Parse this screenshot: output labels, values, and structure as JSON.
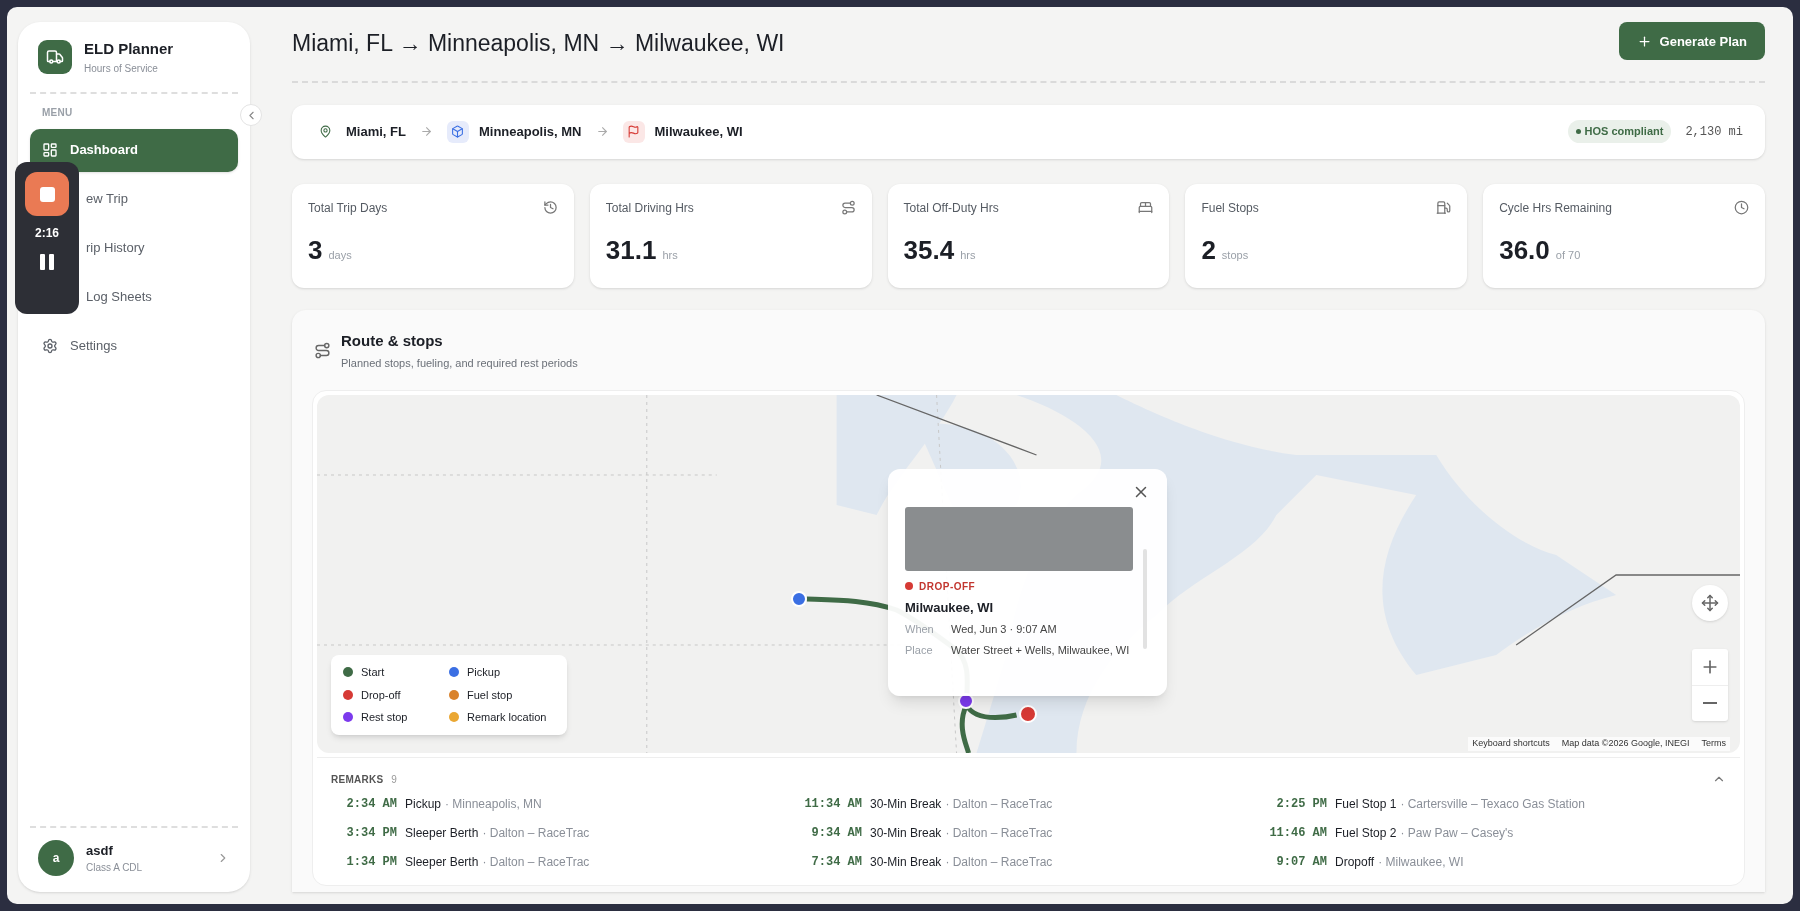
{
  "app": {
    "name": "ELD Planner",
    "subtitle": "Hours of Service"
  },
  "sidebar": {
    "section": "MENU",
    "items": [
      {
        "label": "Dashboard",
        "selected": true
      },
      {
        "label": "ew Trip",
        "selected": false
      },
      {
        "label": "rip History",
        "selected": false
      },
      {
        "label": "Log Sheets",
        "selected": false
      },
      {
        "label": "Settings",
        "selected": false
      }
    ]
  },
  "recorder": {
    "time": "2:16"
  },
  "user": {
    "initial": "a",
    "name": "asdf",
    "role": "Class A CDL"
  },
  "header": {
    "title": "Miami, FL → Minneapolis, MN → Milwaukee, WI",
    "button": "Generate Plan"
  },
  "trip": {
    "stops": [
      {
        "kind": "start",
        "label": "Miami, FL"
      },
      {
        "kind": "pickup",
        "label": "Minneapolis, MN"
      },
      {
        "kind": "dropoff",
        "label": "Milwaukee, WI"
      }
    ],
    "badge": "HOS compliant",
    "distance": "2,130 mi"
  },
  "stats": [
    {
      "label": "Total Trip Days",
      "value": "3",
      "unit": "days"
    },
    {
      "label": "Total Driving Hrs",
      "value": "31.1",
      "unit": "hrs"
    },
    {
      "label": "Total Off-Duty Hrs",
      "value": "35.4",
      "unit": "hrs"
    },
    {
      "label": "Fuel Stops",
      "value": "2",
      "unit": "stops"
    },
    {
      "label": "Cycle Hrs Remaining",
      "value": "36.0",
      "unit": "of 70"
    }
  ],
  "route": {
    "title": "Route & stops",
    "subtitle": "Planned stops, fueling, and required rest periods"
  },
  "map": {
    "legend": [
      {
        "label": "Start",
        "color": "#3f6b46"
      },
      {
        "label": "Pickup",
        "color": "#3b6fe3"
      },
      {
        "label": "Drop-off",
        "color": "#d63a35"
      },
      {
        "label": "Fuel stop",
        "color": "#d9822b"
      },
      {
        "label": "Rest stop",
        "color": "#7c3aed"
      },
      {
        "label": "Remark location",
        "color": "#eaa733"
      }
    ],
    "popup": {
      "tag": "DROP-OFF",
      "title": "Milwaukee, WI",
      "fields": [
        {
          "label": "When",
          "value": "Wed, Jun 3 · 9:07 AM"
        },
        {
          "label": "Place",
          "value": "Water Street + Wells, Milwaukee, WI"
        }
      ]
    },
    "attribution": [
      "Keyboard shortcuts",
      "Map data ©2026 Google, INEGI",
      "Terms"
    ]
  },
  "remarks": {
    "title": "REMARKS",
    "count": "9",
    "expanded": true,
    "items": [
      {
        "time": "2:34 AM",
        "title": "Pickup",
        "detail": "· Minneapolis, MN"
      },
      {
        "time": "11:34 AM",
        "title": "30-Min Break",
        "detail": "· Dalton – RaceTrac"
      },
      {
        "time": "2:25 PM",
        "title": "Fuel Stop 1",
        "detail": "· Cartersville – Texaco Gas Station"
      },
      {
        "time": "3:34 PM",
        "title": "Sleeper Berth",
        "detail": "· Dalton – RaceTrac"
      },
      {
        "time": "9:34 AM",
        "title": "30-Min Break",
        "detail": "· Dalton – RaceTrac"
      },
      {
        "time": "11:46 AM",
        "title": "Fuel Stop 2",
        "detail": "· Paw Paw – Casey's"
      },
      {
        "time": "1:34 PM",
        "title": "Sleeper Berth",
        "detail": "· Dalton – RaceTrac"
      },
      {
        "time": "7:34 AM",
        "title": "30-Min Break",
        "detail": "· Dalton – RaceTrac"
      },
      {
        "time": "9:07 AM",
        "title": "Dropoff",
        "detail": "· Milwaukee, WI"
      }
    ]
  }
}
